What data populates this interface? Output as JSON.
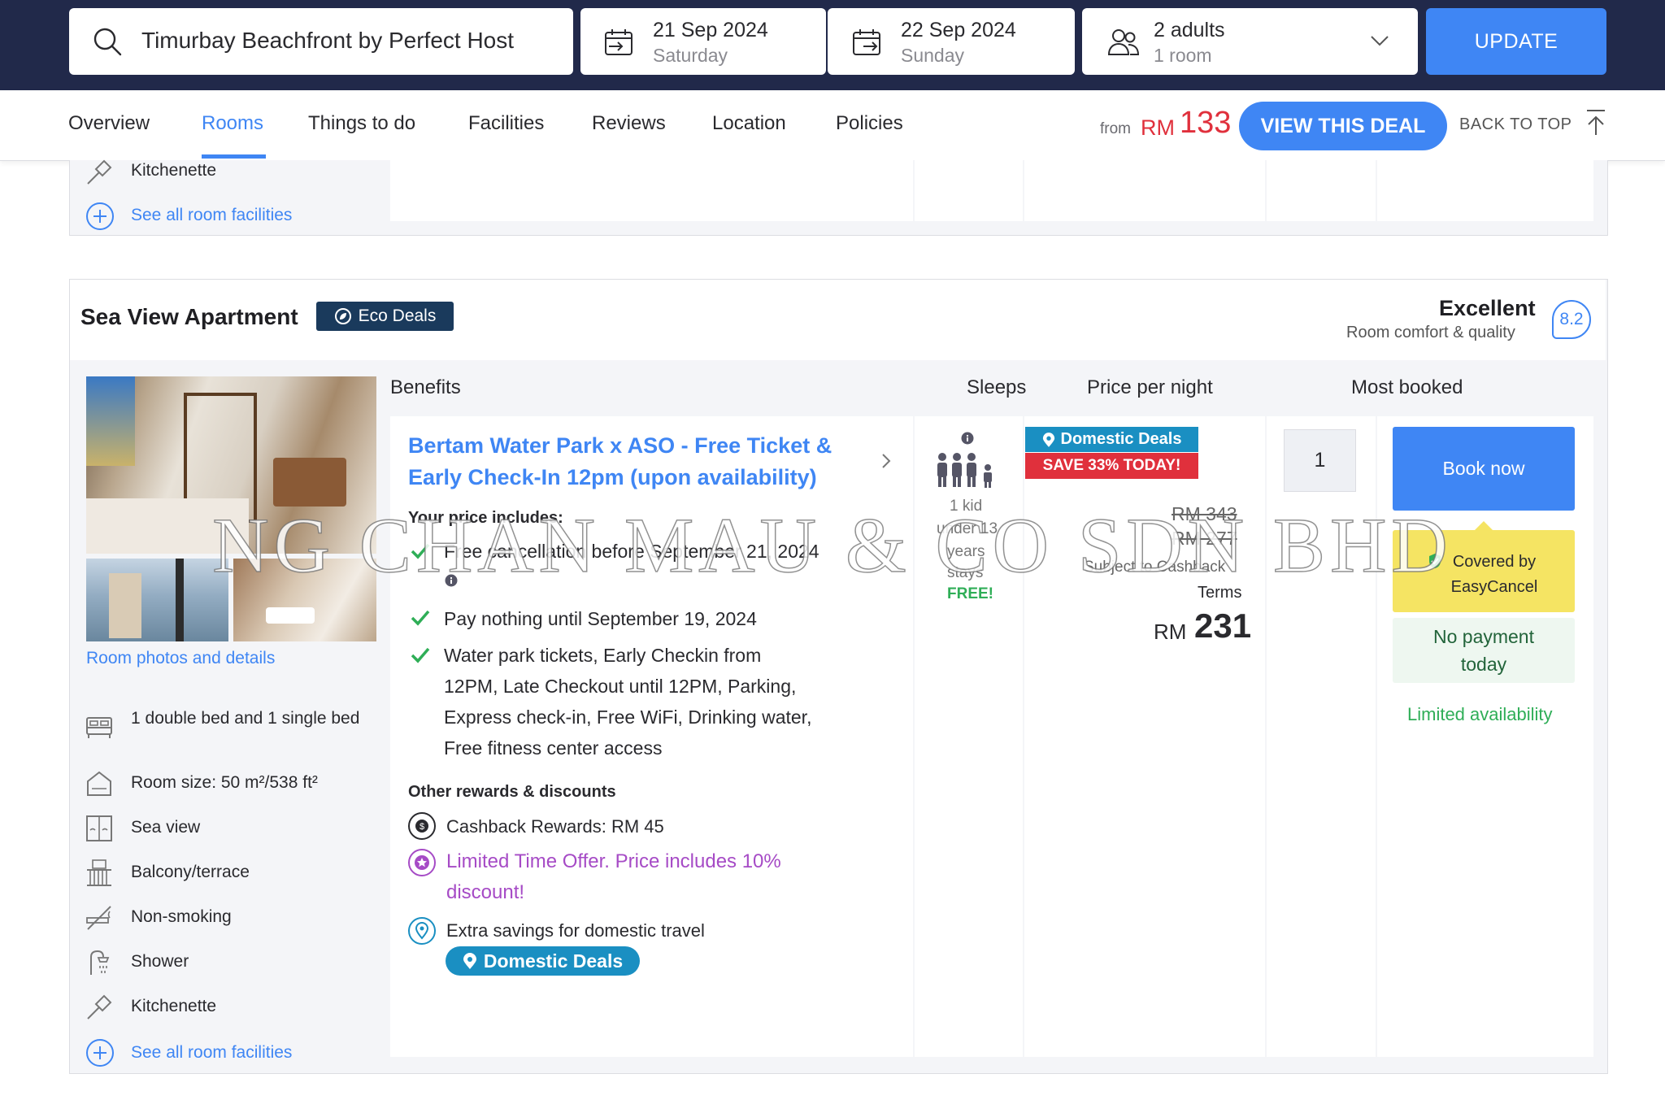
{
  "search": {
    "hotel_name": "Timurbay Beachfront by Perfect Host",
    "checkin_date": "21 Sep 2024",
    "checkin_day": "Saturday",
    "checkout_date": "22 Sep 2024",
    "checkout_day": "Sunday",
    "guests": "2 adults",
    "rooms": "1 room",
    "update_label": "UPDATE"
  },
  "nav": {
    "tabs": [
      "Overview",
      "Rooms",
      "Things to do",
      "Facilities",
      "Reviews",
      "Location",
      "Policies"
    ],
    "active_tab": "Rooms",
    "from_label": "from",
    "currency": "RM",
    "from_price": "133",
    "deal_button": "VIEW THIS DEAL",
    "back_to_top": "BACK TO TOP"
  },
  "prev_room": {
    "last_facility": "Kitchenette",
    "see_all": "See all room facilities"
  },
  "room": {
    "name": "Sea View Apartment",
    "badge": "Eco Deals",
    "rating_label": "Excellent",
    "rating_sub": "Room comfort & quality",
    "rating_score": "8.2",
    "photos_link": "Room photos and details",
    "facilities": [
      {
        "icon": "bed-icon",
        "text": "1 double bed and 1 single bed"
      },
      {
        "icon": "room-size-icon",
        "text": "Room size: 50 m²/538 ft²"
      },
      {
        "icon": "sea-view-icon",
        "text": "Sea view"
      },
      {
        "icon": "balcony-icon",
        "text": "Balcony/terrace"
      },
      {
        "icon": "no-smoking-icon",
        "text": "Non-smoking"
      },
      {
        "icon": "shower-icon",
        "text": "Shower"
      },
      {
        "icon": "kitchenette-icon",
        "text": "Kitchenette"
      }
    ],
    "see_all": "See all room facilities"
  },
  "table_headers": {
    "benefits": "Benefits",
    "sleeps": "Sleeps",
    "price": "Price per night",
    "most_booked": "Most booked"
  },
  "offer": {
    "title_line1": "Bertam Water Park x ASO - Free Ticket &",
    "title_line2": "Early Check-In 12pm (upon availability)",
    "includes_label": "Your price includes:",
    "includes": [
      "Free cancellation before September 21, 2024",
      "Pay nothing until September 19, 2024",
      "Water park tickets, Early Checkin from",
      "12PM, Late Checkout until 12PM, Parking,",
      "Express check-in, Free WiFi, Drinking water,",
      "Free fitness center access"
    ],
    "rewards_label": "Other rewards & discounts",
    "cashback": "Cashback Rewards: RM 45",
    "limited_offer_1": "Limited Time Offer. Price includes 10%",
    "limited_offer_2": "discount!",
    "domestic_text": "Extra savings for domestic travel",
    "domestic_badge": "Domestic Deals"
  },
  "sleeps": {
    "kid_1": "1 kid",
    "kid_2": "under 13",
    "kid_3": "years",
    "kid_4": "stays",
    "free": "FREE!"
  },
  "price": {
    "domestic_badge": "Domestic Deals",
    "save_badge": "SAVE 33% TODAY!",
    "original_1": "RM 343",
    "original_2": "RM 277",
    "cashback_note": "Subject to Cashback",
    "terms": "Terms",
    "currency": "RM",
    "final": "231"
  },
  "booking": {
    "qty": "1",
    "book_now": "Book now",
    "covered": "Covered by EasyCancel",
    "no_payment": "No payment today",
    "limited": "Limited availability"
  },
  "watermark": "NG CHAN MAU & CO SDN BHD",
  "colors": {
    "header_bg": "#21294a",
    "accent_blue": "#3f86f4",
    "deal_red": "#e0303c",
    "eco_badge": "#1a3a5c",
    "green": "#2fae57",
    "purple": "#a64bc6",
    "easycancel_yellow": "#f5e463"
  }
}
